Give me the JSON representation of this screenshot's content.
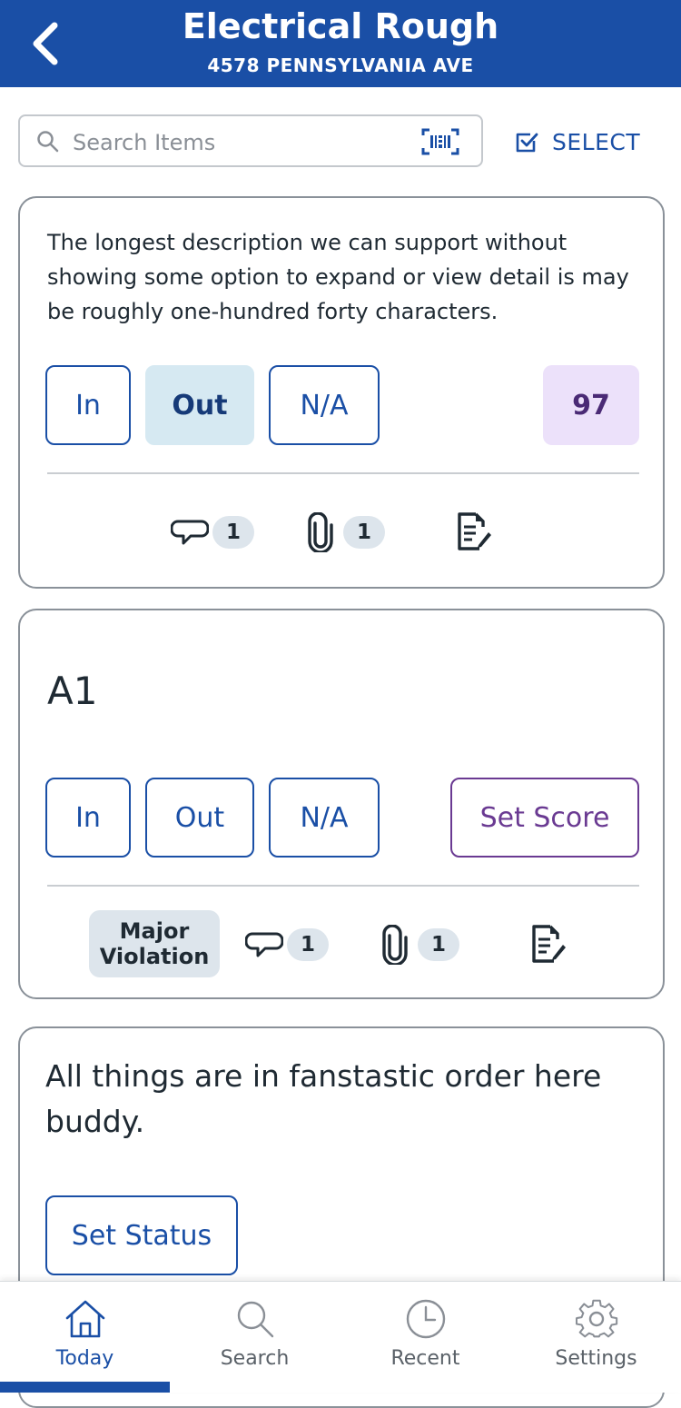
{
  "header": {
    "title": "Electrical Rough",
    "subtitle": "4578 PENNSYLVANIA AVE",
    "background_color": "#1a4fa6",
    "back_icon": "chevron-left-icon"
  },
  "search": {
    "placeholder": "Search Items",
    "value": "",
    "icon": "search-icon",
    "scan_icon": "barcode-scan-icon"
  },
  "select_action": {
    "label": "SELECT",
    "icon": "checkbox-icon"
  },
  "cards": [
    {
      "description": "The longest description we can support without showing some option to expand or view detail is may be roughly one-hundred forty characters.",
      "options": [
        {
          "label": "In",
          "selected": false
        },
        {
          "label": "Out",
          "selected": true
        },
        {
          "label": "N/A",
          "selected": false
        }
      ],
      "score": "97",
      "comments_count": "1",
      "attachments_count": "1"
    },
    {
      "title": "A1",
      "options": [
        {
          "label": "In",
          "selected": false
        },
        {
          "label": "Out",
          "selected": false
        },
        {
          "label": "N/A",
          "selected": false
        }
      ],
      "set_score_label": "Set Score",
      "violation_label": "Major Violation",
      "comments_count": "1",
      "attachments_count": "1"
    },
    {
      "description": "All things are in fanstastic order here buddy.",
      "set_status_label": "Set Status"
    }
  ],
  "nav": {
    "items": [
      {
        "label": "Today",
        "icon": "home-icon",
        "active": true
      },
      {
        "label": "Search",
        "icon": "search-icon",
        "active": false
      },
      {
        "label": "Recent",
        "icon": "clock-icon",
        "active": false
      },
      {
        "label": "Settings",
        "icon": "gear-icon",
        "active": false
      }
    ],
    "active_color": "#1a4fa6"
  }
}
